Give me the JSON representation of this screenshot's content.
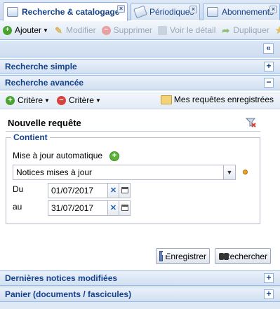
{
  "tabs": [
    {
      "label": "Recherche & catalogage",
      "active": true
    },
    {
      "label": "Périodiques",
      "active": false
    },
    {
      "label": "Abonnements",
      "active": false
    }
  ],
  "toolbar": {
    "add": "Ajouter",
    "edit": "Modifier",
    "delete": "Supprimer",
    "view": "Voir le détail",
    "duplicate": "Dupliquer"
  },
  "panels": {
    "simple_search": "Recherche simple",
    "advanced_search": "Recherche avancée",
    "recent_notices": "Dernières notices modifiées",
    "cart": "Panier (documents / fascicules)"
  },
  "criteria_bar": {
    "add_criterion": "Critère",
    "remove_criterion": "Critère",
    "saved_queries": "Mes requêtes enregistrées"
  },
  "query": {
    "title": "Nouvelle requête",
    "fieldset_legend": "Contient",
    "auto_update_label": "Mise à jour automatique",
    "select_value": "Notices mises à jour",
    "from_label": "Du",
    "from_value": "01/07/2017",
    "to_label": "au",
    "to_value": "31/07/2017"
  },
  "actions": {
    "save": "Enregistrer",
    "search": "Rechercher"
  }
}
